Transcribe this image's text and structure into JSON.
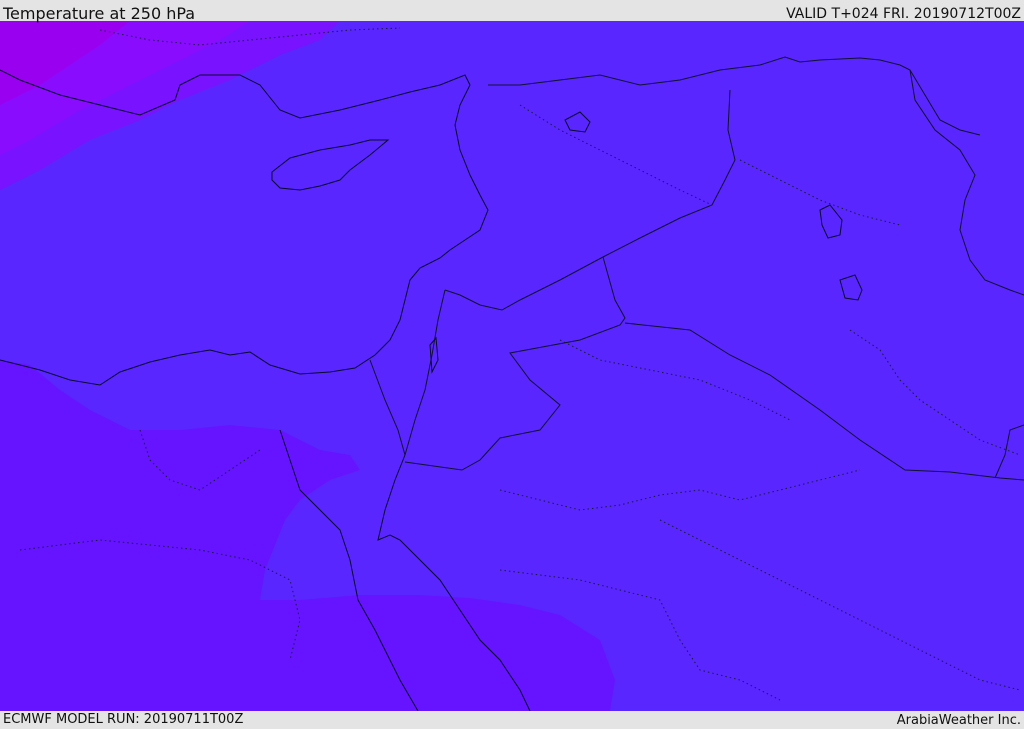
{
  "header": {
    "title": "Temperature at 250 hPa",
    "valid": "VALID T+024 FRI. 20190712T00Z"
  },
  "footer": {
    "model_run": "ECMWF MODEL RUN: 20190711T00Z",
    "credit": "ArabiaWeather Inc."
  },
  "map": {
    "colors": {
      "background_band": "#5a26ff",
      "warm_band": "#6614ff",
      "north_band_a": "#7812ff",
      "north_band_b": "#8a0cff",
      "north_band_c": "#9a00f0",
      "coastline": "#0a0a30"
    }
  }
}
